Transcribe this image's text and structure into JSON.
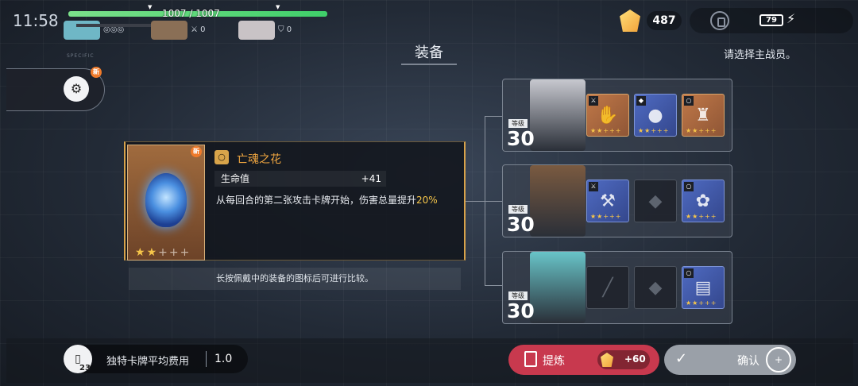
{
  "status_bar": {
    "time": "11:58",
    "crystals": "487",
    "battery": "79"
  },
  "party": {
    "hp_text": "1007 / 1007",
    "hp_fraction": 1.0,
    "members": [
      {
        "stat": "",
        "color": "#6fb7c6"
      },
      {
        "stat": "0",
        "color": "#8a6f56"
      },
      {
        "stat": "0",
        "color": "#c9c3c6"
      }
    ]
  },
  "header": {
    "title": "装备",
    "instruction": "请选择主战员。",
    "small_caption": "SPECIFIC"
  },
  "left_tab": {
    "icon": "gear-faction-icon",
    "new_badge": "新"
  },
  "item": {
    "new_badge": "新",
    "name": "亡魂之花",
    "stat_name": "生命值",
    "stat_value": "+41",
    "desc_part1": "从每回合的第二张攻击卡牌开始，伤害总量提升",
    "desc_highlight": "20%",
    "rarity": 2,
    "rarity_max": 5,
    "hint": "长按佩戴中的装备的图标后可进行比较。"
  },
  "characters": [
    {
      "level_label": "等级",
      "level": "30",
      "portrait_color": "#c7c8cf",
      "slots": [
        {
          "type": "orange",
          "glyph": "✋",
          "tag": "⚔",
          "stars": "★★+++"
        },
        {
          "type": "blue",
          "glyph": "●",
          "tag": "◆",
          "stars": "★★+++"
        },
        {
          "type": "orange",
          "glyph": "♜",
          "tag": "○",
          "stars": "★★+++"
        }
      ]
    },
    {
      "level_label": "等级",
      "level": "30",
      "portrait_color": "#7a5a40",
      "slots": [
        {
          "type": "blue",
          "glyph": "⚒",
          "tag": "⚔",
          "stars": "★★+++"
        },
        {
          "type": "empty",
          "glyph": "◆",
          "tag": "",
          "stars": ""
        },
        {
          "type": "blue",
          "glyph": "✿",
          "tag": "○",
          "stars": "★★+++"
        }
      ]
    },
    {
      "level_label": "等级",
      "level": "30",
      "portrait_color": "#68c4c8",
      "slots": [
        {
          "type": "empty",
          "glyph": "╱",
          "tag": "",
          "stars": ""
        },
        {
          "type": "empty",
          "glyph": "◆",
          "tag": "",
          "stars": ""
        },
        {
          "type": "blue",
          "glyph": "▤",
          "tag": "○",
          "stars": "★★+++"
        }
      ]
    }
  ],
  "footer": {
    "card_count": "23",
    "cost_label": "独特卡牌平均费用",
    "cost_value": "1.0",
    "refine_label": "提炼",
    "refine_cost": "+60",
    "confirm_label": "确认"
  }
}
